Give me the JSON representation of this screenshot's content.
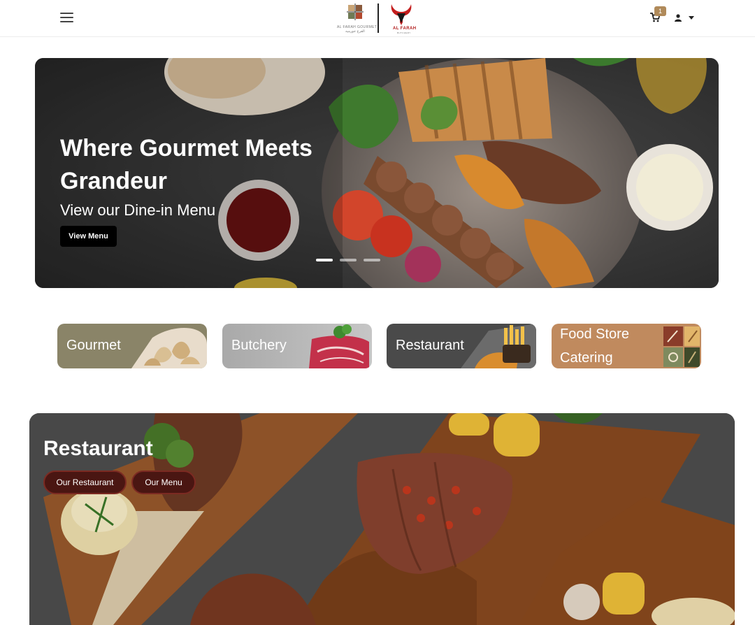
{
  "header": {
    "menu_icon": "hamburger-menu-icon",
    "logo_left_en": "AL FARAH GOURMET",
    "logo_left_ar": "الفرح جورميه",
    "logo_right_en": "AL FARAH",
    "logo_right_sub": "BUTCHERY",
    "cart_icon": "cart-icon",
    "cart_count": "1",
    "user_icon": "user-icon",
    "dropdown_icon": "caret-down-icon"
  },
  "hero": {
    "title": "Where Gourmet Meets Grandeur",
    "subtitle": "View our Dine-in Menu",
    "button_label": "View Menu",
    "slides": 3,
    "active_slide": 1
  },
  "categories": [
    {
      "label": "Gourmet"
    },
    {
      "label": "Butchery"
    },
    {
      "label": "Restaurant"
    },
    {
      "label_line1": "Food Store",
      "label_line2": "Catering"
    }
  ],
  "restaurant": {
    "title": "Restaurant",
    "buttons": [
      "Our Restaurant",
      "Our Menu"
    ]
  },
  "colors": {
    "accent_gold": "#b08a5a",
    "pill_bg": "#4a1612",
    "gourmet_tile": "#8a8468",
    "butchery_tile": "#b7b7b7",
    "restaurant_tile": "#4a4a4a",
    "foodstore_tile": "#c08a5e"
  }
}
